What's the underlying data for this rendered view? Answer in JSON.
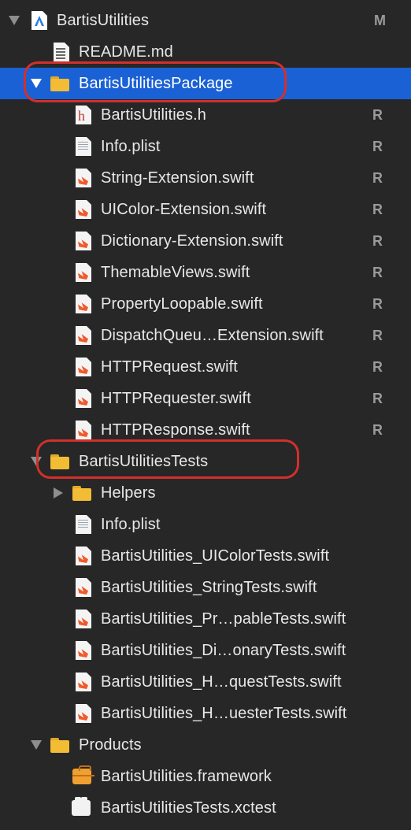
{
  "tree": {
    "root": {
      "label": "BartisUtilities",
      "badge": "M",
      "icon": "xcode-project-icon"
    },
    "readme": {
      "label": "README.md",
      "icon": "markdown-file-icon"
    },
    "package": {
      "label": "BartisUtilitiesPackage",
      "icon": "folder-icon",
      "selected": true,
      "files": [
        {
          "label": "BartisUtilities.h",
          "badge": "R",
          "icon": "header-file-icon"
        },
        {
          "label": "Info.plist",
          "badge": "R",
          "icon": "plist-file-icon"
        },
        {
          "label": "String-Extension.swift",
          "badge": "R",
          "icon": "swift-file-icon"
        },
        {
          "label": "UIColor-Extension.swift",
          "badge": "R",
          "icon": "swift-file-icon"
        },
        {
          "label": "Dictionary-Extension.swift",
          "badge": "R",
          "icon": "swift-file-icon"
        },
        {
          "label": "ThemableViews.swift",
          "badge": "R",
          "icon": "swift-file-icon"
        },
        {
          "label": "PropertyLoopable.swift",
          "badge": "R",
          "icon": "swift-file-icon"
        },
        {
          "label": "DispatchQueu…Extension.swift",
          "badge": "R",
          "icon": "swift-file-icon"
        },
        {
          "label": "HTTPRequest.swift",
          "badge": "R",
          "icon": "swift-file-icon"
        },
        {
          "label": "HTTPRequester.swift",
          "badge": "R",
          "icon": "swift-file-icon"
        },
        {
          "label": "HTTPResponse.swift",
          "badge": "R",
          "icon": "swift-file-icon"
        }
      ]
    },
    "tests": {
      "label": "BartisUtilitiesTests",
      "icon": "folder-icon",
      "helpers": {
        "label": "Helpers",
        "icon": "folder-icon"
      },
      "files": [
        {
          "label": "Info.plist",
          "icon": "plist-file-icon"
        },
        {
          "label": "BartisUtilities_UIColorTests.swift",
          "icon": "swift-file-icon"
        },
        {
          "label": "BartisUtilities_StringTests.swift",
          "icon": "swift-file-icon"
        },
        {
          "label": "BartisUtilities_Pr…pableTests.swift",
          "icon": "swift-file-icon"
        },
        {
          "label": "BartisUtilities_Di…onaryTests.swift",
          "icon": "swift-file-icon"
        },
        {
          "label": "BartisUtilities_H…questTests.swift",
          "icon": "swift-file-icon"
        },
        {
          "label": "BartisUtilities_H…uesterTests.swift",
          "icon": "swift-file-icon"
        }
      ]
    },
    "products": {
      "label": "Products",
      "icon": "folder-icon",
      "files": [
        {
          "label": "BartisUtilities.framework",
          "icon": "framework-icon"
        },
        {
          "label": "BartisUtilitiesTests.xctest",
          "icon": "xctest-bundle-icon"
        }
      ]
    }
  },
  "colors": {
    "background": "#272727",
    "selection": "#1a61d6",
    "annotation_ring": "#d2302c",
    "folder": "#f2bc35",
    "swift": "#f05a2a"
  }
}
